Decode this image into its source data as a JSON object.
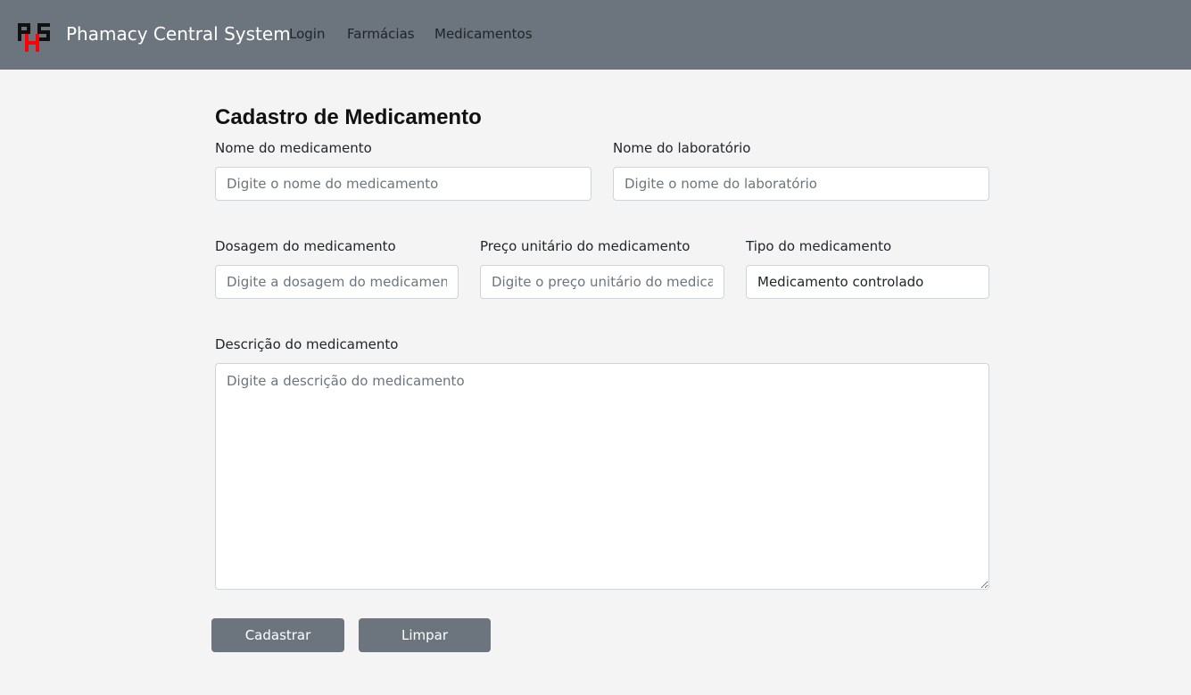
{
  "navbar": {
    "logo_icon": "phs-logo-icon",
    "brand": "Phamacy Central System",
    "links": [
      "Login",
      "Farmácias",
      "Medicamentos"
    ]
  },
  "form": {
    "title": "Cadastro de Medicamento",
    "nome": {
      "label": "Nome do medicamento",
      "placeholder": "Digite o nome do medicamento",
      "value": ""
    },
    "laboratorio": {
      "label": "Nome do laboratório",
      "placeholder": "Digite o nome do laboratório",
      "value": ""
    },
    "dosagem": {
      "label": "Dosagem do medicamento",
      "placeholder": "Digite a dosagem do medicamento",
      "value": ""
    },
    "preco": {
      "label": "Preço unitário do medicamento",
      "placeholder": "Digite o preço unitário do medicamento",
      "value": ""
    },
    "tipo": {
      "label": "Tipo do medicamento",
      "value": "Medicamento controlado"
    },
    "descricao": {
      "label": "Descrição do medicamento",
      "placeholder": "Digite a descrição do medicamento",
      "value": ""
    },
    "buttons": {
      "submit": "Cadastrar",
      "clear": "Limpar"
    }
  },
  "colors": {
    "navbar": "#6c757d",
    "button": "#6c757d",
    "logo_red": "#ff0000",
    "logo_black": "#111111"
  }
}
